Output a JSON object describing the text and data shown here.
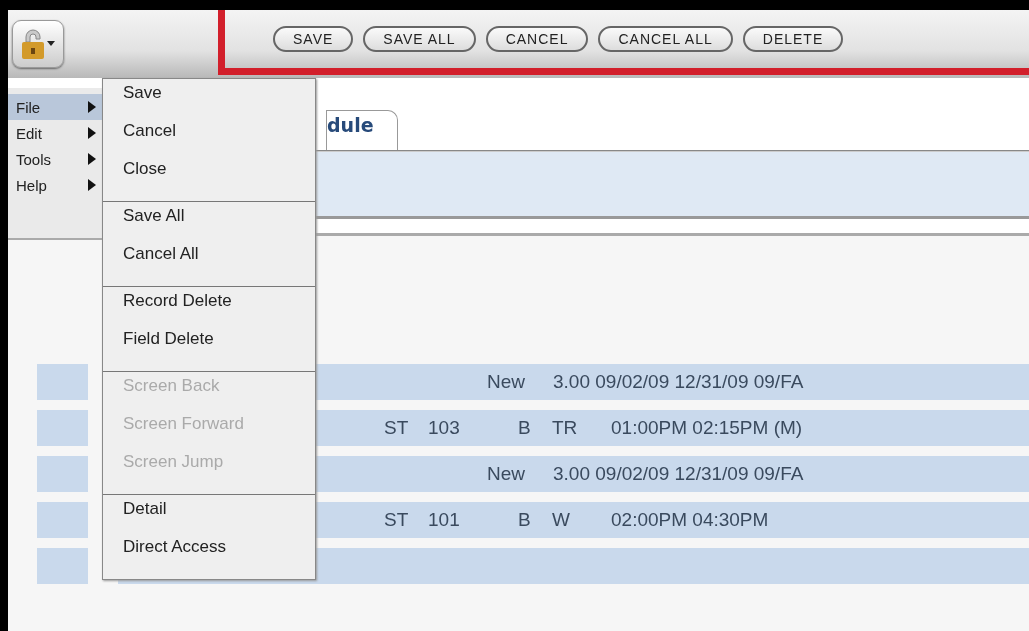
{
  "toolbar": {
    "buttons": [
      {
        "label": "SAVE"
      },
      {
        "label": "SAVE ALL"
      },
      {
        "label": "CANCEL"
      },
      {
        "label": "CANCEL ALL"
      },
      {
        "label": "DELETE"
      }
    ],
    "highlighted": true
  },
  "tab": {
    "label": "dule"
  },
  "rows": [
    {
      "kind": "section",
      "status": "New",
      "info": "3.00 09/02/09 12/31/09 09/FA"
    },
    {
      "kind": "meeting",
      "type": "ST",
      "room": "103",
      "building": "B",
      "days": "TR",
      "times": "01:00PM 02:15PM (M)"
    },
    {
      "kind": "section",
      "status": "New",
      "info": "3.00 09/02/09 12/31/09 09/FA"
    },
    {
      "kind": "meeting",
      "type": "ST",
      "room": "101",
      "building": "B",
      "days": "W",
      "times": "02:00PM 04:30PM"
    },
    {
      "kind": "blank"
    }
  ],
  "menu": {
    "items": [
      {
        "label": "File",
        "selected": true
      },
      {
        "label": "Edit",
        "selected": false
      },
      {
        "label": "Tools",
        "selected": false
      },
      {
        "label": "Help",
        "selected": false
      }
    ],
    "submenu": [
      [
        {
          "label": "Save",
          "disabled": false
        },
        {
          "label": "Cancel",
          "disabled": false
        },
        {
          "label": "Close",
          "disabled": false
        }
      ],
      [
        {
          "label": "Save All",
          "disabled": false
        },
        {
          "label": "Cancel All",
          "disabled": false
        }
      ],
      [
        {
          "label": "Record Delete",
          "disabled": false
        },
        {
          "label": "Field Delete",
          "disabled": false
        }
      ],
      [
        {
          "label": "Screen Back",
          "disabled": true
        },
        {
          "label": "Screen Forward",
          "disabled": true
        },
        {
          "label": "Screen Jump",
          "disabled": true
        }
      ],
      [
        {
          "label": "Detail",
          "disabled": false
        },
        {
          "label": "Direct Access",
          "disabled": false
        }
      ]
    ]
  }
}
